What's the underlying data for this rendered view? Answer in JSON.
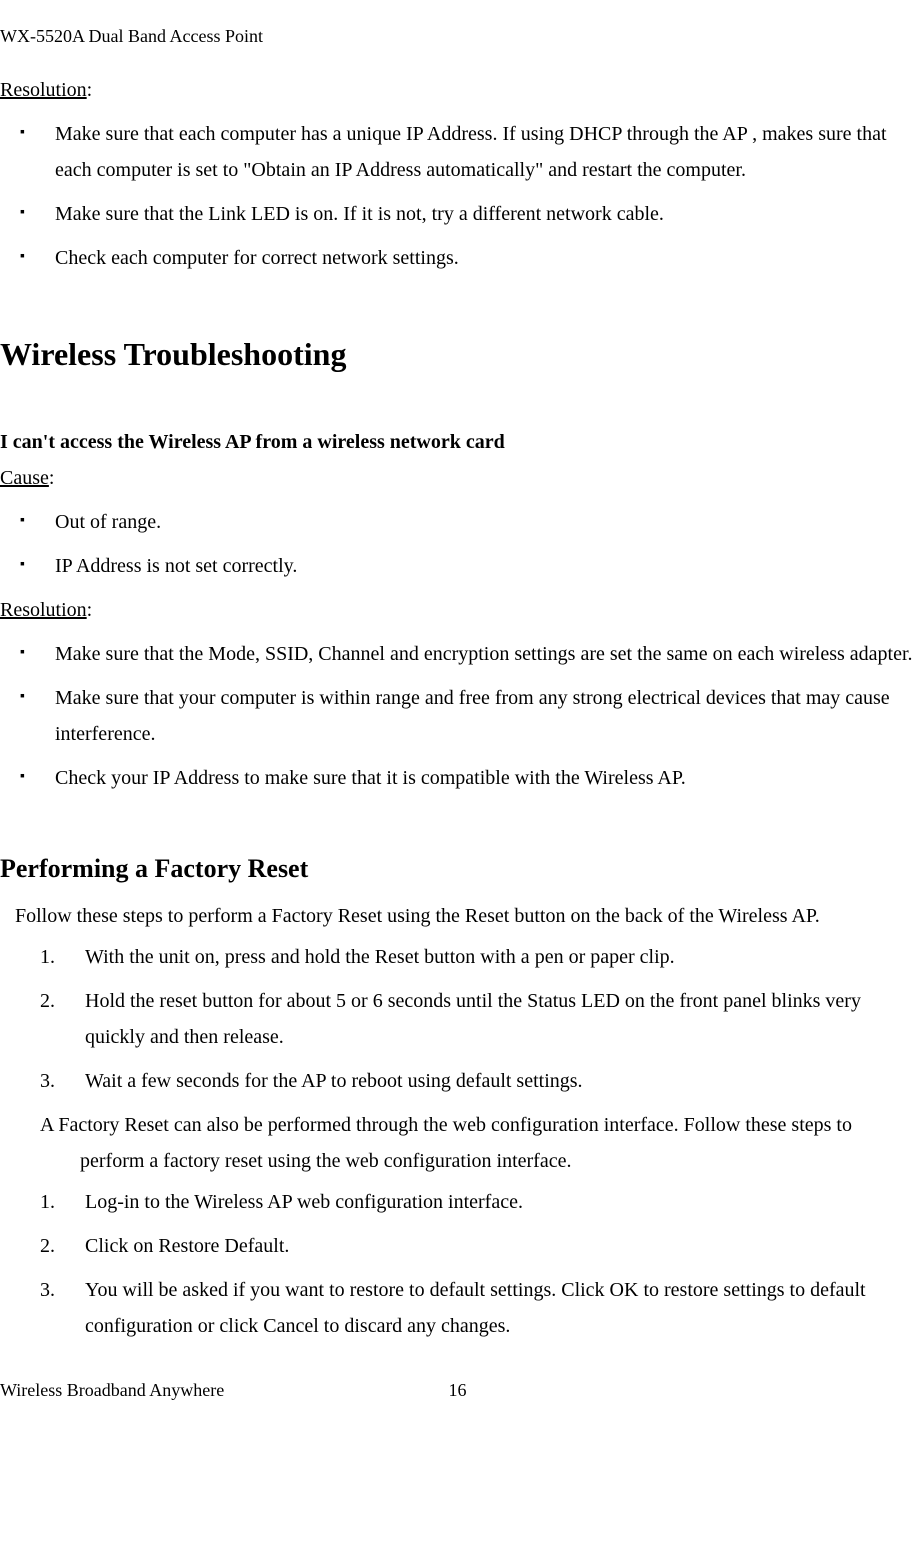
{
  "header": "WX-5520A Dual Band Access Point",
  "resolution1": {
    "title": "Resolution",
    "items": [
      "Make sure that each computer has a unique IP Address. If using DHCP through the AP , makes sure that each computer is set to \"Obtain an IP Address automatically\" and restart the computer.",
      "Make sure that the Link LED is on. If it is not, try a different network cable.",
      "Check each computer for correct network settings."
    ]
  },
  "h1": "Wireless Troubleshooting",
  "issue": {
    "title": "I can't access the Wireless AP from a wireless network card",
    "causeLabel": "Cause",
    "causes": [
      "Out of range.",
      "IP Address is not set correctly."
    ],
    "resolutionLabel": "Resolution",
    "resolutions": [
      "Make sure that the Mode, SSID, Channel and encryption settings are set the same on each wireless adapter.",
      "Make sure that your computer is within range and free from any strong electrical devices that may cause interference.",
      "Check your IP Address to make sure that it is compatible with the Wireless AP."
    ]
  },
  "factory": {
    "title": "Performing a Factory Reset",
    "intro": "Follow these steps to perform a Factory Reset using the Reset button on the back of the Wireless AP.",
    "steps1": [
      "With the unit on, press and hold the Reset button with a pen or paper clip.",
      "Hold the reset button for about 5 or 6 seconds until the Status LED on the front panel blinks very quickly and then release.",
      "Wait a few seconds for the AP to reboot using default settings."
    ],
    "mid": "A Factory Reset can also be performed through the web configuration interface. Follow these steps to perform a factory reset using the web configuration interface.",
    "steps2": [
      "Log-in to the Wireless AP web configuration interface.",
      "Click on Restore Default.",
      "You will be asked if you want to restore to default settings. Click OK to restore settings to default configuration or click Cancel to discard any changes."
    ]
  },
  "footer": {
    "left": "Wireless Broadband Anywhere",
    "page": "16"
  }
}
